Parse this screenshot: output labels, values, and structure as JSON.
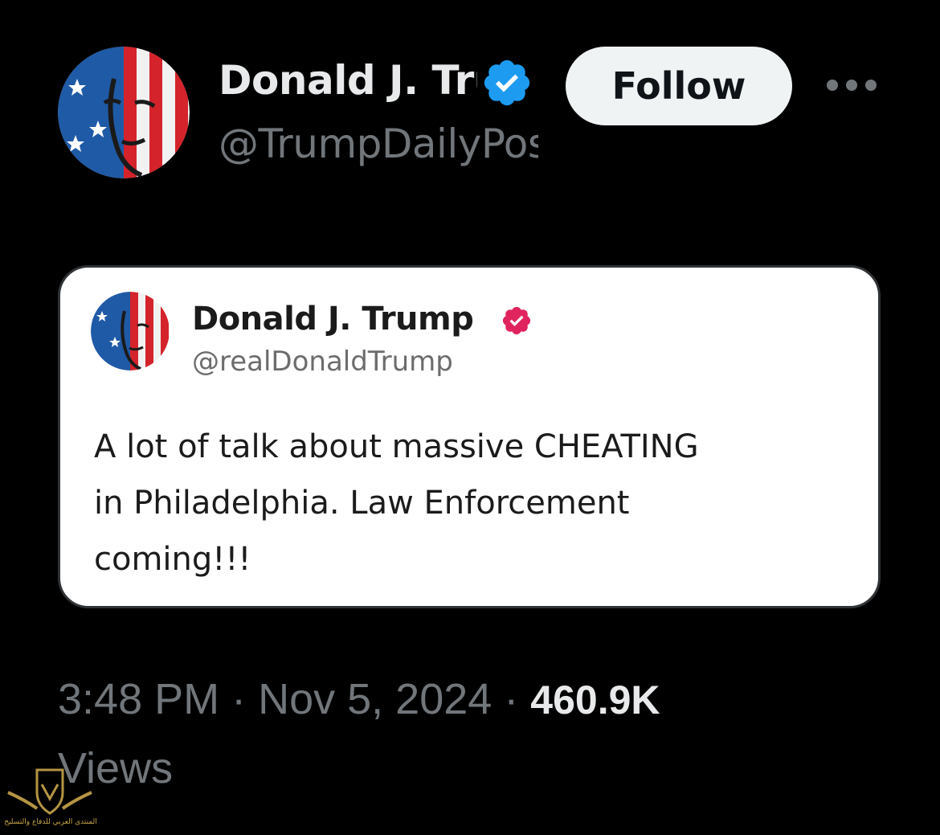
{
  "tweet": {
    "author": {
      "display_name": "Donald J. Trump",
      "handle": "@TrumpDailyPosts",
      "verified_badge_icon": "verified-badge-icon",
      "badge_color": "#1d9bf0"
    },
    "follow_label": "Follow",
    "more_icon": "more-horizontal-icon",
    "timestamp": "3:48 PM · Nov 5, 2024 ·",
    "views_count": "460.9K",
    "views_label": "Views"
  },
  "quoted_post": {
    "display_name": "Donald J. Trump",
    "handle": "@realDonaldTrump",
    "verified_badge_icon": "verified-badge-icon",
    "badge_color": "#e0245e",
    "text_lines": [
      "A lot of talk about massive CHEATING",
      "in Philadelphia. Law Enforcement",
      "coming!!!"
    ]
  },
  "watermark": {
    "text": "المنتدى العربي للدفاع والتسليح"
  },
  "colors": {
    "background": "#000000",
    "primary_text": "#e7e9ea",
    "secondary_text": "#71767b",
    "follow_bg": "#eff3f4",
    "card_bg": "#ffffff"
  }
}
